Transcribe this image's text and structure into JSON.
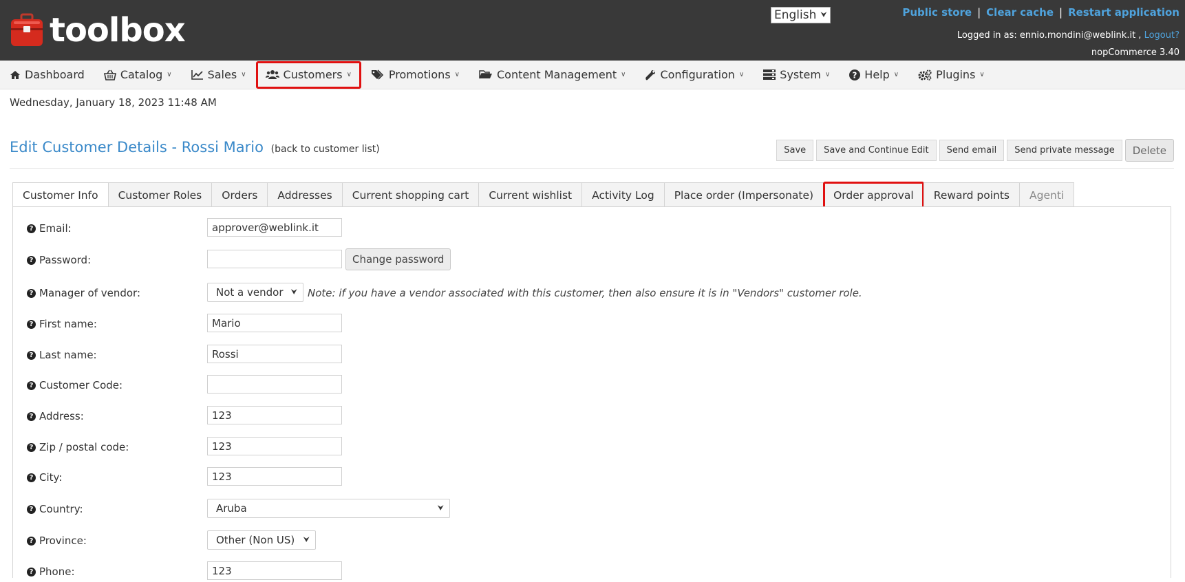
{
  "header": {
    "logo_text": "toolbox",
    "language": "English",
    "links": [
      "Public store",
      "Clear cache",
      "Restart application"
    ],
    "logged_in_prefix": "Logged in as: ennio.mondini@weblink.it ,",
    "logout": "Logout?",
    "version": "nopCommerce 3.40"
  },
  "nav": [
    {
      "label": "Dashboard",
      "icon": "home-icon"
    },
    {
      "label": "Catalog",
      "icon": "basket-icon"
    },
    {
      "label": "Sales",
      "icon": "line-chart-icon"
    },
    {
      "label": "Customers",
      "icon": "users-icon"
    },
    {
      "label": "Promotions",
      "icon": "tags-icon"
    },
    {
      "label": "Content Management",
      "icon": "folder-open-icon"
    },
    {
      "label": "Configuration",
      "icon": "wrench-icon"
    },
    {
      "label": "System",
      "icon": "server-icon"
    },
    {
      "label": "Help",
      "icon": "question-circle-icon"
    },
    {
      "label": "Plugins",
      "icon": "gears-icon"
    }
  ],
  "date": "Wednesday, January 18, 2023 11:48 AM",
  "page": {
    "title": "Edit Customer Details - Rossi Mario",
    "back": "(back to customer list)"
  },
  "actions": {
    "save": "Save",
    "save_continue": "Save and Continue Edit",
    "send_email": "Send email",
    "send_pm": "Send private message",
    "delete": "Delete"
  },
  "tabs": [
    "Customer Info",
    "Customer Roles",
    "Orders",
    "Addresses",
    "Current shopping cart",
    "Current wishlist",
    "Activity Log",
    "Place order (Impersonate)",
    "Order approval",
    "Reward points",
    "Agenti"
  ],
  "form": {
    "email": {
      "label": "Email:",
      "value": "approver@weblink.it"
    },
    "password": {
      "label": "Password:",
      "value": "",
      "button": "Change password"
    },
    "vendor": {
      "label": "Manager of vendor:",
      "value": "Not a vendor",
      "note": "Note: if you have a vendor associated with this customer, then also ensure it is in \"Vendors\" customer role."
    },
    "first_name": {
      "label": "First name:",
      "value": "Mario"
    },
    "last_name": {
      "label": "Last name:",
      "value": "Rossi"
    },
    "customer_code": {
      "label": "Customer Code:",
      "value": ""
    },
    "address": {
      "label": "Address:",
      "value": "123"
    },
    "zip": {
      "label": "Zip / postal code:",
      "value": "123"
    },
    "city": {
      "label": "City:",
      "value": "123"
    },
    "country": {
      "label": "Country:",
      "value": "Aruba"
    },
    "province": {
      "label": "Province:",
      "value": "Other (Non US)"
    },
    "phone": {
      "label": "Phone:",
      "value": "123"
    }
  },
  "colors": {
    "header_bg": "#393939",
    "link": "#4fa3dd",
    "title": "#3a89c9",
    "highlight": "#e01010"
  }
}
